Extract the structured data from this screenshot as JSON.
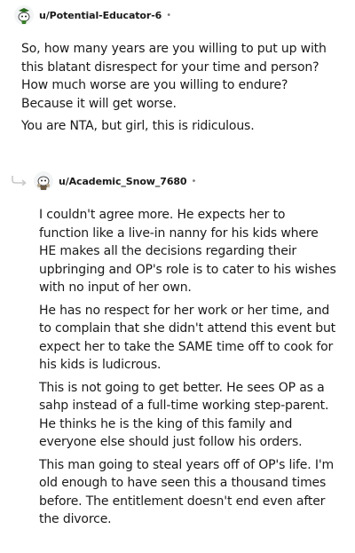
{
  "comments": [
    {
      "username": "u/Potential-Educator-6",
      "separator": "•",
      "avatar_icon": "snoo-avatar-icon",
      "paragraphs": [
        "So, how many years are you willing to put up with this blatant disrespect for your time and person? How much worse are you willing to endure? Because it will get worse.",
        "You are NTA, but girl, this is ridiculous."
      ]
    },
    {
      "username": "u/Academic_Snow_7680",
      "separator": "•",
      "avatar_icon": "snoo-avatar-icon",
      "reply_icon": "reply-arrow-icon",
      "paragraphs": [
        "I couldn't agree more. He expects her to function like a live-in nanny for his kids where HE makes all the decisions regarding their upbringing and OP's role is to cater to his wishes with no input of her own.",
        "He has no respect for her work or her time, and to complain that she didn't attend this event but expect her to take the SAME time off to cook for his kids is ludicrous.",
        "This is not going to get better. He sees OP as a sahp instead of a full-time working step-parent. He thinks he is the king of this family and everyone else should just follow his orders.",
        "This man going to steal years off of OP's life. I'm old enough to have seen this a thousand times before. The entitlement doesn't end even after the divorce."
      ]
    }
  ]
}
